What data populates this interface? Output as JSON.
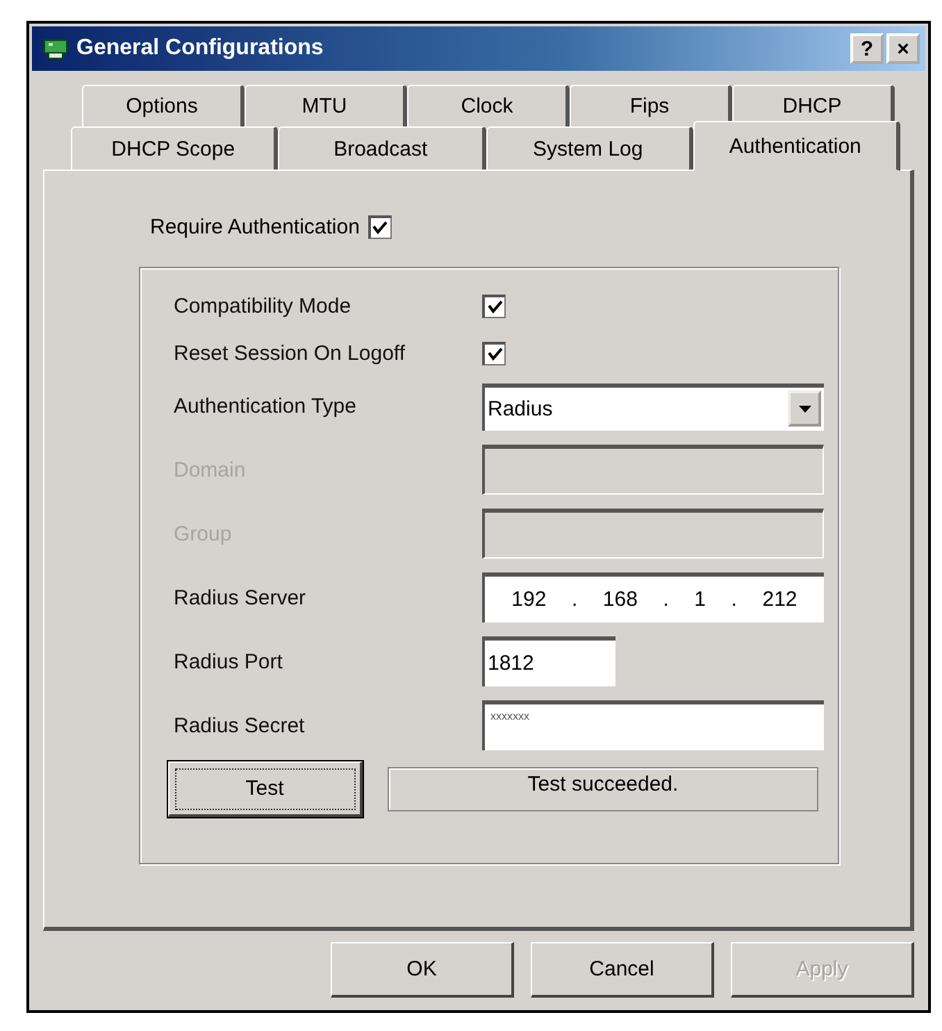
{
  "window": {
    "title": "General Configurations",
    "help": "?",
    "close": "×"
  },
  "tab_rows": [
    [
      {
        "label": "Options",
        "selected": false
      },
      {
        "label": "MTU",
        "selected": false
      },
      {
        "label": "Clock",
        "selected": false
      },
      {
        "label": "Fips",
        "selected": false
      },
      {
        "label": "DHCP",
        "selected": false
      }
    ],
    [
      {
        "label": "DHCP Scope",
        "selected": false
      },
      {
        "label": "Broadcast",
        "selected": false
      },
      {
        "label": "System Log",
        "selected": false
      },
      {
        "label": "Authentication",
        "selected": true
      }
    ]
  ],
  "require_authentication": {
    "label": "Require Authentication",
    "checked": true
  },
  "fields": [
    {
      "kind": "checkbox",
      "label": "Compatibility Mode",
      "checked": true,
      "disabled": false
    },
    {
      "kind": "checkbox",
      "label": "Reset Session On Logoff",
      "checked": true,
      "disabled": false
    },
    {
      "kind": "select",
      "label": "Authentication Type",
      "value": "Radius",
      "disabled": false
    },
    {
      "kind": "text",
      "label": "Domain",
      "disabled": true
    },
    {
      "kind": "text",
      "label": "Group",
      "disabled": true
    },
    {
      "kind": "ip",
      "label": "Radius Server",
      "parts": [
        "192",
        "168",
        "1",
        "212"
      ],
      "separator": ".",
      "disabled": false
    },
    {
      "kind": "short",
      "label": "Radius Port",
      "value": "1812",
      "disabled": false
    },
    {
      "kind": "password",
      "label": "Radius Secret",
      "value": "xxxxxxx",
      "disabled": false
    }
  ],
  "test_button": "Test",
  "test_result": "Test succeeded.",
  "buttons": [
    {
      "label": "OK",
      "disabled": false
    },
    {
      "label": "Cancel",
      "disabled": false
    },
    {
      "label": "Apply",
      "disabled": true
    }
  ]
}
